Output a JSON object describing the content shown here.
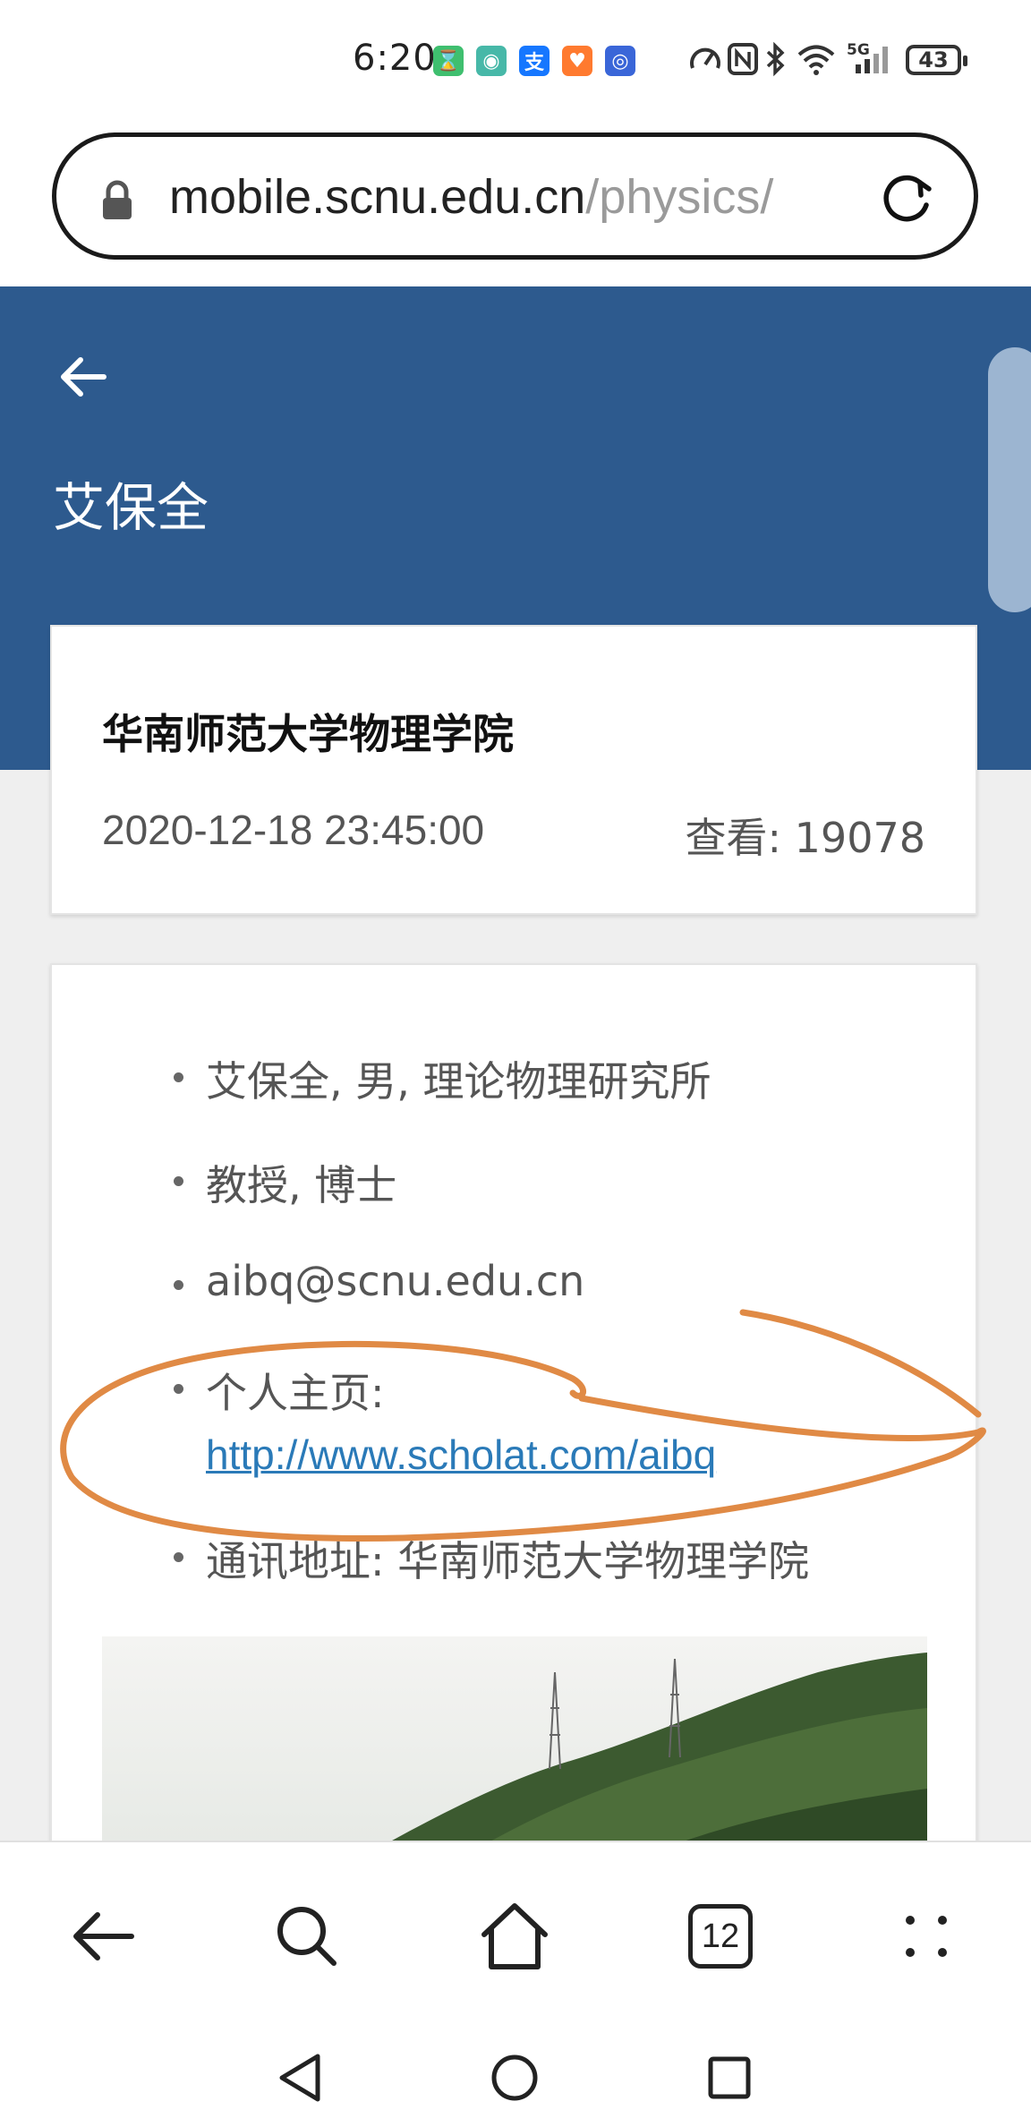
{
  "status_bar": {
    "time": "6:20",
    "network": "5G",
    "battery": "43",
    "app_icons": [
      "hourglass-app-icon",
      "shopping-app-icon",
      "alipay-icon",
      "health-app-icon",
      "browser-app-icon"
    ]
  },
  "url_bar": {
    "domain": "mobile.scnu.edu.cn",
    "path": "/physics/"
  },
  "header": {
    "title": "艾保全"
  },
  "meta": {
    "org": "华南师范大学物理学院",
    "date": "2020-12-18 23:45:00",
    "views_label": "查看:",
    "views_count": "19078"
  },
  "content": {
    "items": [
      "艾保全, 男, 理论物理研究所",
      "教授, 博士",
      "aibq@scnu.edu.cn",
      "个人主页:",
      "通讯地址: 华南师范大学物理学院"
    ],
    "homepage_url": "http://www.scholat.com/aibq"
  },
  "bottom_bar": {
    "tab_count": "12"
  },
  "colors": {
    "header_bg": "#2d5a8e",
    "link": "#2a7ab8",
    "annotation": "#e08a45"
  }
}
